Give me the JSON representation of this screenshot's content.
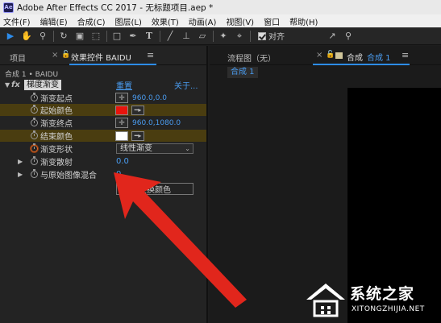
{
  "window": {
    "app_icon": "Ae",
    "title": "Adobe After Effects CC 2017 - 无标题项目.aep *"
  },
  "menu": [
    "文件(F)",
    "编辑(E)",
    "合成(C)",
    "图层(L)",
    "效果(T)",
    "动画(A)",
    "视图(V)",
    "窗口",
    "帮助(H)"
  ],
  "toolbar": {
    "align_label": "对齐"
  },
  "left_panel": {
    "tab_project": "项目",
    "tab_effects": "效果控件 BAIDU",
    "layer_path": "合成 1 • BAIDU",
    "effect": {
      "name": "梯度渐变",
      "reset": "重置",
      "about": "关于...",
      "props": {
        "start_point": {
          "label": "渐变起点",
          "value": "960.0,0.0"
        },
        "start_color": {
          "label": "起始颜色",
          "color": "#e8140c"
        },
        "end_point": {
          "label": "渐变终点",
          "value": "960.0,1080.0"
        },
        "end_color": {
          "label": "结束颜色",
          "color": "#ffffff"
        },
        "shape": {
          "label": "渐变形状",
          "value": "线性渐变"
        },
        "scatter": {
          "label": "渐变散射",
          "value": "0.0"
        },
        "blend": {
          "label": "与原始图像混合",
          "value": "0"
        }
      },
      "swap_button": "交换颜色"
    }
  },
  "right_panel": {
    "tab_flow": "流程图（无）",
    "tab_comp": "合成",
    "tab_comp_name": "合成 1",
    "comp_chip": "合成 1"
  },
  "watermark": {
    "title": "系统之家",
    "url": "XITONGZHIJIA.NET"
  },
  "colors": {
    "accent": "#2d8ceb",
    "link": "#4a9cf0",
    "arrow": "#e1261c"
  }
}
